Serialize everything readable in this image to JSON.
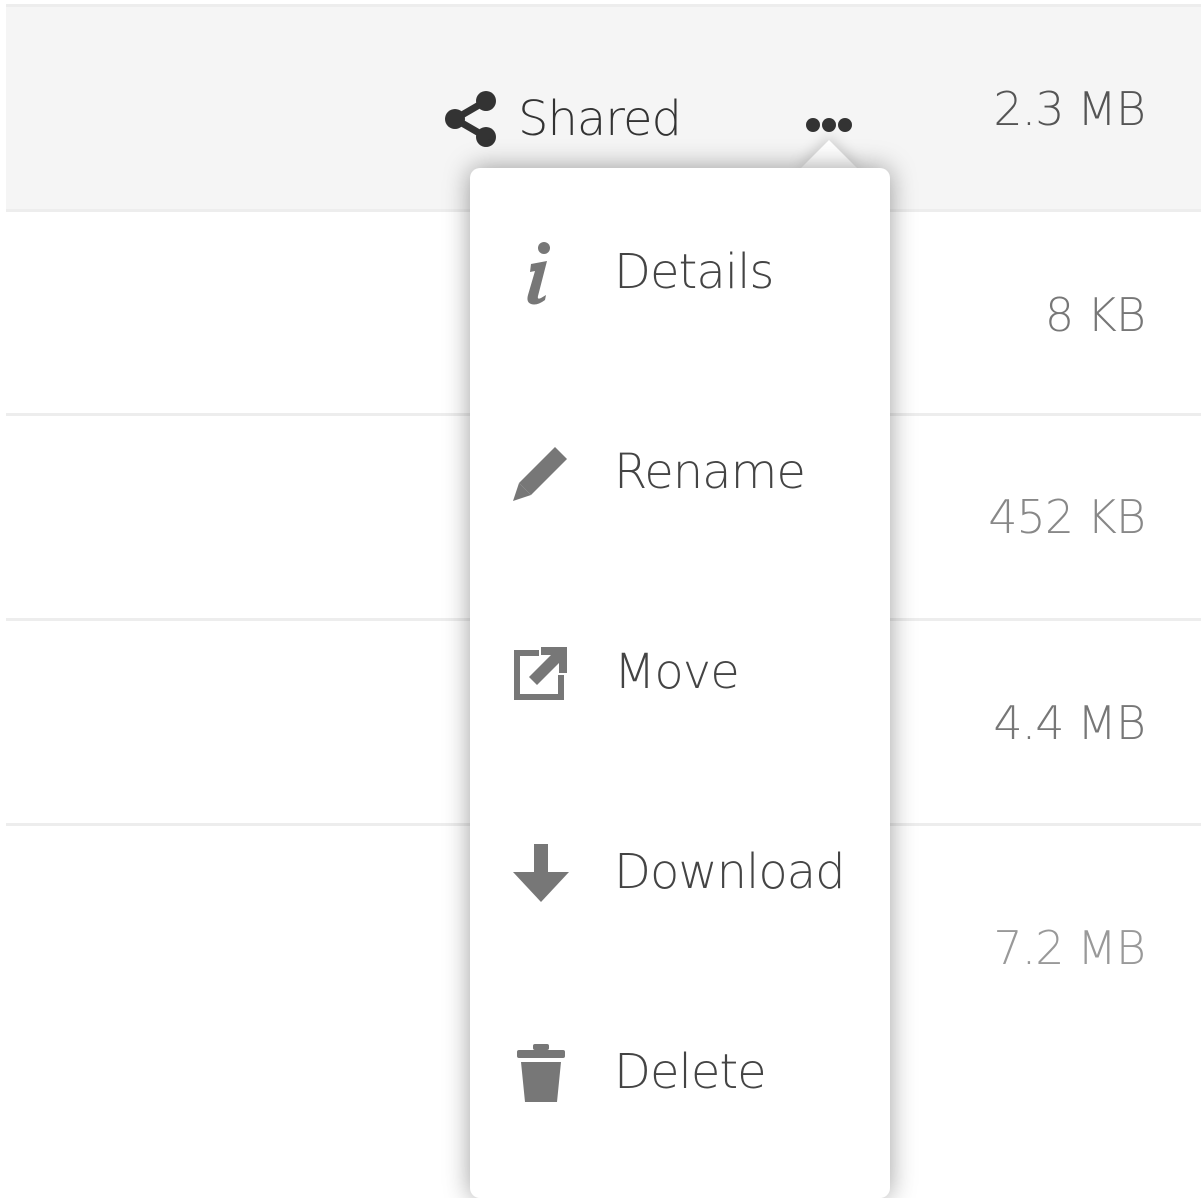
{
  "file_rows": [
    {
      "size": "2.3 MB",
      "shared_label": "Shared"
    },
    {
      "size": "8 KB"
    },
    {
      "size": "452 KB"
    },
    {
      "size": "4.4 MB"
    },
    {
      "size": "7.2 MB"
    }
  ],
  "actions_menu": {
    "items": [
      {
        "label": "Details",
        "icon": "info-icon"
      },
      {
        "label": "Rename",
        "icon": "pencil-icon"
      },
      {
        "label": "Move",
        "icon": "move-icon"
      },
      {
        "label": "Download",
        "icon": "download-icon"
      },
      {
        "label": "Delete",
        "icon": "trash-icon"
      }
    ]
  },
  "colors": {
    "row_highlight": "#f5f5f5",
    "divider": "#ededed",
    "size_text_dark": "#555555",
    "size_text_light": "#999999",
    "menu_text": "#444444",
    "menu_icon": "#777777"
  }
}
